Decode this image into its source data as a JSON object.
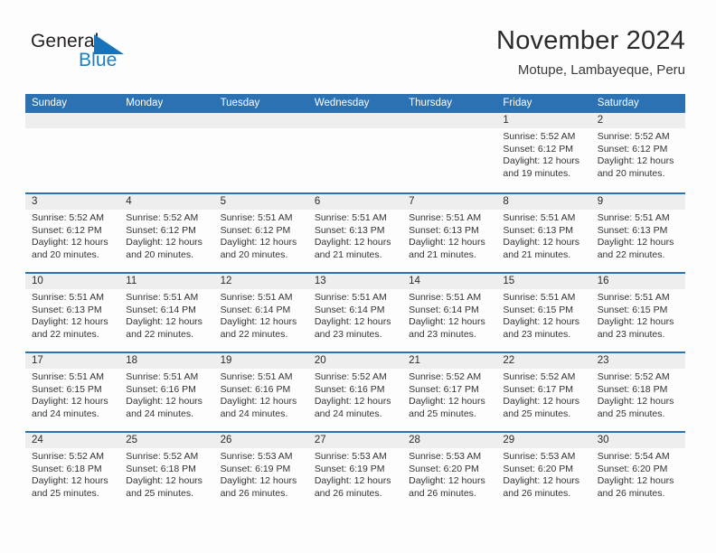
{
  "brand": {
    "name_part1": "General",
    "name_part2": "Blue",
    "triangle_color": "#1a72b8",
    "blue_text_color": "#1a7fc1"
  },
  "header": {
    "month_title": "November 2024",
    "location": "Motupe, Lambayeque, Peru"
  },
  "theme": {
    "header_bar_color": "#2c72b3",
    "day_band_color": "#eeeeee",
    "page_background": "#fdfdfd",
    "text_color": "#333333"
  },
  "weekdays": [
    "Sunday",
    "Monday",
    "Tuesday",
    "Wednesday",
    "Thursday",
    "Friday",
    "Saturday"
  ],
  "weeks": [
    [
      {
        "day": "",
        "empty": true,
        "sunrise": "",
        "sunset": "",
        "daylight_line1": "",
        "daylight_line2": ""
      },
      {
        "day": "",
        "empty": true,
        "sunrise": "",
        "sunset": "",
        "daylight_line1": "",
        "daylight_line2": ""
      },
      {
        "day": "",
        "empty": true,
        "sunrise": "",
        "sunset": "",
        "daylight_line1": "",
        "daylight_line2": ""
      },
      {
        "day": "",
        "empty": true,
        "sunrise": "",
        "sunset": "",
        "daylight_line1": "",
        "daylight_line2": ""
      },
      {
        "day": "",
        "empty": true,
        "sunrise": "",
        "sunset": "",
        "daylight_line1": "",
        "daylight_line2": ""
      },
      {
        "day": "1",
        "empty": false,
        "sunrise": "Sunrise: 5:52 AM",
        "sunset": "Sunset: 6:12 PM",
        "daylight_line1": "Daylight: 12 hours",
        "daylight_line2": "and 19 minutes."
      },
      {
        "day": "2",
        "empty": false,
        "sunrise": "Sunrise: 5:52 AM",
        "sunset": "Sunset: 6:12 PM",
        "daylight_line1": "Daylight: 12 hours",
        "daylight_line2": "and 20 minutes."
      }
    ],
    [
      {
        "day": "3",
        "empty": false,
        "sunrise": "Sunrise: 5:52 AM",
        "sunset": "Sunset: 6:12 PM",
        "daylight_line1": "Daylight: 12 hours",
        "daylight_line2": "and 20 minutes."
      },
      {
        "day": "4",
        "empty": false,
        "sunrise": "Sunrise: 5:52 AM",
        "sunset": "Sunset: 6:12 PM",
        "daylight_line1": "Daylight: 12 hours",
        "daylight_line2": "and 20 minutes."
      },
      {
        "day": "5",
        "empty": false,
        "sunrise": "Sunrise: 5:51 AM",
        "sunset": "Sunset: 6:12 PM",
        "daylight_line1": "Daylight: 12 hours",
        "daylight_line2": "and 20 minutes."
      },
      {
        "day": "6",
        "empty": false,
        "sunrise": "Sunrise: 5:51 AM",
        "sunset": "Sunset: 6:13 PM",
        "daylight_line1": "Daylight: 12 hours",
        "daylight_line2": "and 21 minutes."
      },
      {
        "day": "7",
        "empty": false,
        "sunrise": "Sunrise: 5:51 AM",
        "sunset": "Sunset: 6:13 PM",
        "daylight_line1": "Daylight: 12 hours",
        "daylight_line2": "and 21 minutes."
      },
      {
        "day": "8",
        "empty": false,
        "sunrise": "Sunrise: 5:51 AM",
        "sunset": "Sunset: 6:13 PM",
        "daylight_line1": "Daylight: 12 hours",
        "daylight_line2": "and 21 minutes."
      },
      {
        "day": "9",
        "empty": false,
        "sunrise": "Sunrise: 5:51 AM",
        "sunset": "Sunset: 6:13 PM",
        "daylight_line1": "Daylight: 12 hours",
        "daylight_line2": "and 22 minutes."
      }
    ],
    [
      {
        "day": "10",
        "empty": false,
        "sunrise": "Sunrise: 5:51 AM",
        "sunset": "Sunset: 6:13 PM",
        "daylight_line1": "Daylight: 12 hours",
        "daylight_line2": "and 22 minutes."
      },
      {
        "day": "11",
        "empty": false,
        "sunrise": "Sunrise: 5:51 AM",
        "sunset": "Sunset: 6:14 PM",
        "daylight_line1": "Daylight: 12 hours",
        "daylight_line2": "and 22 minutes."
      },
      {
        "day": "12",
        "empty": false,
        "sunrise": "Sunrise: 5:51 AM",
        "sunset": "Sunset: 6:14 PM",
        "daylight_line1": "Daylight: 12 hours",
        "daylight_line2": "and 22 minutes."
      },
      {
        "day": "13",
        "empty": false,
        "sunrise": "Sunrise: 5:51 AM",
        "sunset": "Sunset: 6:14 PM",
        "daylight_line1": "Daylight: 12 hours",
        "daylight_line2": "and 23 minutes."
      },
      {
        "day": "14",
        "empty": false,
        "sunrise": "Sunrise: 5:51 AM",
        "sunset": "Sunset: 6:14 PM",
        "daylight_line1": "Daylight: 12 hours",
        "daylight_line2": "and 23 minutes."
      },
      {
        "day": "15",
        "empty": false,
        "sunrise": "Sunrise: 5:51 AM",
        "sunset": "Sunset: 6:15 PM",
        "daylight_line1": "Daylight: 12 hours",
        "daylight_line2": "and 23 minutes."
      },
      {
        "day": "16",
        "empty": false,
        "sunrise": "Sunrise: 5:51 AM",
        "sunset": "Sunset: 6:15 PM",
        "daylight_line1": "Daylight: 12 hours",
        "daylight_line2": "and 23 minutes."
      }
    ],
    [
      {
        "day": "17",
        "empty": false,
        "sunrise": "Sunrise: 5:51 AM",
        "sunset": "Sunset: 6:15 PM",
        "daylight_line1": "Daylight: 12 hours",
        "daylight_line2": "and 24 minutes."
      },
      {
        "day": "18",
        "empty": false,
        "sunrise": "Sunrise: 5:51 AM",
        "sunset": "Sunset: 6:16 PM",
        "daylight_line1": "Daylight: 12 hours",
        "daylight_line2": "and 24 minutes."
      },
      {
        "day": "19",
        "empty": false,
        "sunrise": "Sunrise: 5:51 AM",
        "sunset": "Sunset: 6:16 PM",
        "daylight_line1": "Daylight: 12 hours",
        "daylight_line2": "and 24 minutes."
      },
      {
        "day": "20",
        "empty": false,
        "sunrise": "Sunrise: 5:52 AM",
        "sunset": "Sunset: 6:16 PM",
        "daylight_line1": "Daylight: 12 hours",
        "daylight_line2": "and 24 minutes."
      },
      {
        "day": "21",
        "empty": false,
        "sunrise": "Sunrise: 5:52 AM",
        "sunset": "Sunset: 6:17 PM",
        "daylight_line1": "Daylight: 12 hours",
        "daylight_line2": "and 25 minutes."
      },
      {
        "day": "22",
        "empty": false,
        "sunrise": "Sunrise: 5:52 AM",
        "sunset": "Sunset: 6:17 PM",
        "daylight_line1": "Daylight: 12 hours",
        "daylight_line2": "and 25 minutes."
      },
      {
        "day": "23",
        "empty": false,
        "sunrise": "Sunrise: 5:52 AM",
        "sunset": "Sunset: 6:18 PM",
        "daylight_line1": "Daylight: 12 hours",
        "daylight_line2": "and 25 minutes."
      }
    ],
    [
      {
        "day": "24",
        "empty": false,
        "sunrise": "Sunrise: 5:52 AM",
        "sunset": "Sunset: 6:18 PM",
        "daylight_line1": "Daylight: 12 hours",
        "daylight_line2": "and 25 minutes."
      },
      {
        "day": "25",
        "empty": false,
        "sunrise": "Sunrise: 5:52 AM",
        "sunset": "Sunset: 6:18 PM",
        "daylight_line1": "Daylight: 12 hours",
        "daylight_line2": "and 25 minutes."
      },
      {
        "day": "26",
        "empty": false,
        "sunrise": "Sunrise: 5:53 AM",
        "sunset": "Sunset: 6:19 PM",
        "daylight_line1": "Daylight: 12 hours",
        "daylight_line2": "and 26 minutes."
      },
      {
        "day": "27",
        "empty": false,
        "sunrise": "Sunrise: 5:53 AM",
        "sunset": "Sunset: 6:19 PM",
        "daylight_line1": "Daylight: 12 hours",
        "daylight_line2": "and 26 minutes."
      },
      {
        "day": "28",
        "empty": false,
        "sunrise": "Sunrise: 5:53 AM",
        "sunset": "Sunset: 6:20 PM",
        "daylight_line1": "Daylight: 12 hours",
        "daylight_line2": "and 26 minutes."
      },
      {
        "day": "29",
        "empty": false,
        "sunrise": "Sunrise: 5:53 AM",
        "sunset": "Sunset: 6:20 PM",
        "daylight_line1": "Daylight: 12 hours",
        "daylight_line2": "and 26 minutes."
      },
      {
        "day": "30",
        "empty": false,
        "sunrise": "Sunrise: 5:54 AM",
        "sunset": "Sunset: 6:20 PM",
        "daylight_line1": "Daylight: 12 hours",
        "daylight_line2": "and 26 minutes."
      }
    ]
  ]
}
